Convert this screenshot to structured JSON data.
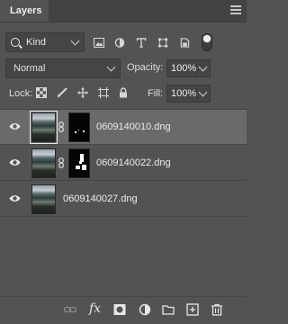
{
  "panel": {
    "title": "Layers",
    "menu_icon": "panel-menu-icon"
  },
  "filter": {
    "kind_label": "Kind",
    "icons": [
      "pixel-filter-icon",
      "adjustment-filter-icon",
      "type-filter-icon",
      "shape-filter-icon",
      "smart-object-filter-icon",
      "filter-toggle-icon"
    ]
  },
  "blend": {
    "mode": "Normal",
    "opacity_label": "Opacity:",
    "opacity_value": "100%"
  },
  "lock": {
    "label": "Lock:",
    "icons": [
      "lock-transparent-pixels-icon",
      "lock-image-pixels-icon",
      "lock-position-icon",
      "lock-artboard-icon",
      "lock-all-icon"
    ],
    "fill_label": "Fill:",
    "fill_value": "100%"
  },
  "layers": [
    {
      "name": "0609140010.dng",
      "has_mask": true,
      "selected": true
    },
    {
      "name": "0609140022.dng",
      "has_mask": true,
      "selected": false
    },
    {
      "name": "0609140027.dng",
      "has_mask": false,
      "selected": false
    }
  ],
  "footer_icons": [
    "link-layers-icon",
    "fx-icon",
    "add-mask-icon",
    "adjustment-layer-icon",
    "new-group-icon",
    "new-layer-icon",
    "delete-layer-icon"
  ],
  "footer": {
    "fx_label": "fx"
  }
}
